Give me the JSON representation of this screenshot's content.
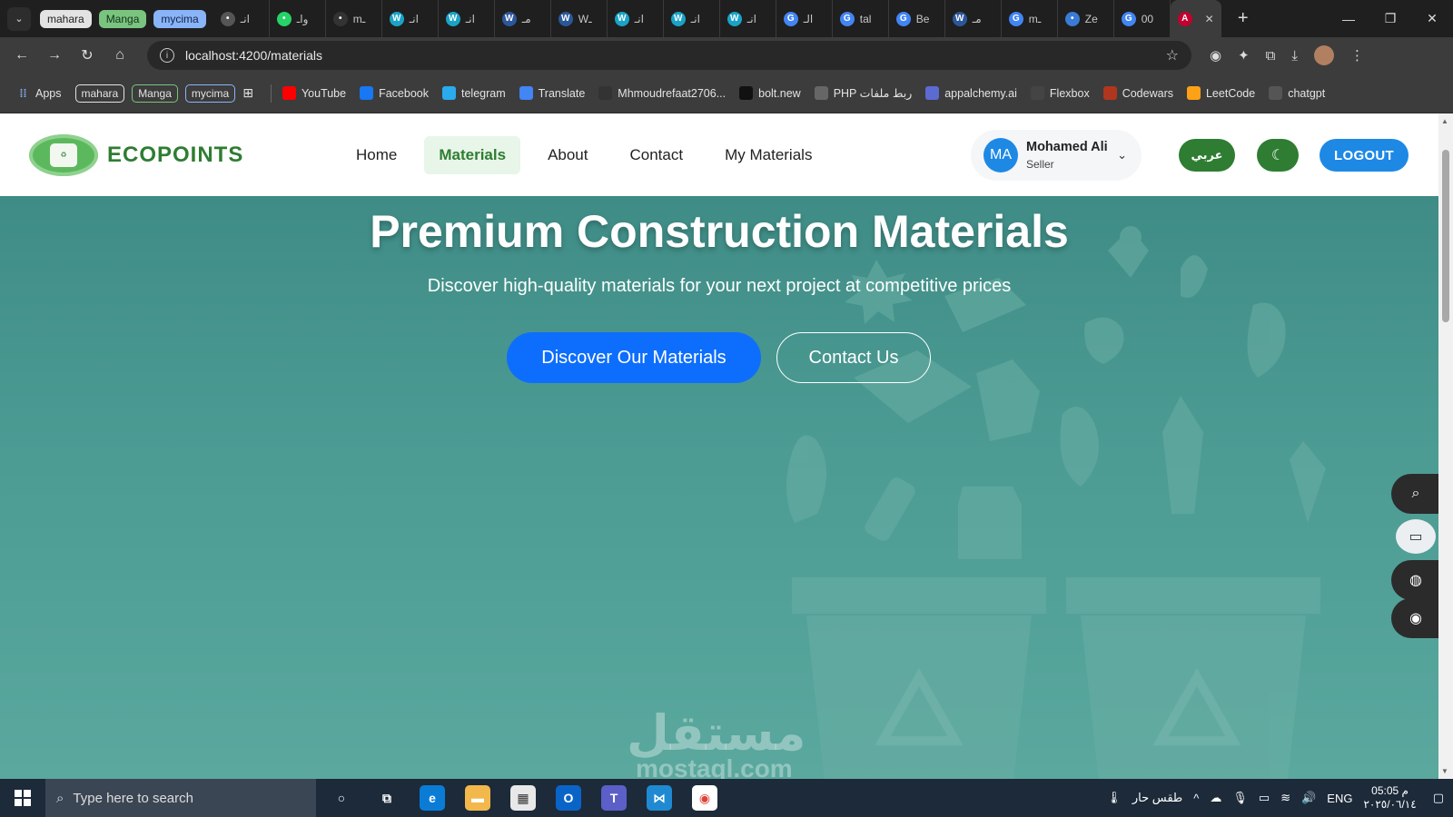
{
  "browser": {
    "tab_groups": [
      "mahara",
      "Manga",
      "mycima"
    ],
    "tabs": [
      {
        "label": "انـ",
        "icon": "openai-icon",
        "color": "#555555"
      },
      {
        "label": "واـ",
        "icon": "whatsapp-icon",
        "color": "#25D366"
      },
      {
        "label": "mـ",
        "icon": "github-icon",
        "color": "#333333"
      },
      {
        "label": "انـ",
        "icon": "w-icon",
        "color": "#1aa3c7"
      },
      {
        "label": "انـ",
        "icon": "w-icon",
        "color": "#1aa3c7"
      },
      {
        "label": "مـ",
        "icon": "w-icon",
        "color": "#2b579a"
      },
      {
        "label": "Wـ",
        "icon": "w-icon",
        "color": "#2b579a"
      },
      {
        "label": "انـ",
        "icon": "w-icon",
        "color": "#1aa3c7"
      },
      {
        "label": "انـ",
        "icon": "w-icon",
        "color": "#1aa3c7"
      },
      {
        "label": "انـ",
        "icon": "w-icon",
        "color": "#1aa3c7"
      },
      {
        "label": "الـ",
        "icon": "google-icon",
        "color": "#4285F4"
      },
      {
        "label": "tal",
        "icon": "google-icon",
        "color": "#4285F4"
      },
      {
        "label": "Be",
        "icon": "google-icon",
        "color": "#4285F4"
      },
      {
        "label": "مـ",
        "icon": "w-icon",
        "color": "#2b579a"
      },
      {
        "label": "mـ",
        "icon": "google-icon",
        "color": "#4285F4"
      },
      {
        "label": "Ze",
        "icon": "ze-icon",
        "color": "#3a7bd5"
      },
      {
        "label": "00",
        "icon": "google-icon",
        "color": "#4285F4"
      }
    ],
    "active_tab_icon": "angular-icon",
    "url": "localhost:4200/materials",
    "bookmarks": {
      "apps": "Apps",
      "groups": [
        "mahara",
        "Manga",
        "mycima"
      ],
      "items": [
        {
          "label": "YouTube",
          "color": "#ff0000"
        },
        {
          "label": "Facebook",
          "color": "#1877f2"
        },
        {
          "label": "telegram",
          "color": "#2aabee"
        },
        {
          "label": "Translate",
          "color": "#4285f4"
        },
        {
          "label": "Mhmoudrefaat2706...",
          "color": "#333333"
        },
        {
          "label": "bolt.new",
          "color": "#111111"
        },
        {
          "label": "PHP ربط ملفات",
          "color": "#666666"
        },
        {
          "label": "appalchemy.ai",
          "color": "#5b6bd1"
        },
        {
          "label": "Flexbox",
          "color": "#444444"
        },
        {
          "label": "Codewars",
          "color": "#b1361e"
        },
        {
          "label": "LeetCode",
          "color": "#ffa116"
        },
        {
          "label": "chatgpt",
          "color": "#555555"
        }
      ]
    }
  },
  "site": {
    "brand": "ECOPOINTS",
    "nav": [
      {
        "label": "Home",
        "active": false
      },
      {
        "label": "Materials",
        "active": true
      },
      {
        "label": "About",
        "active": false
      },
      {
        "label": "Contact",
        "active": false
      },
      {
        "label": "My Materials",
        "active": false
      }
    ],
    "user": {
      "initials": "MA",
      "name": "Mohamed Ali",
      "role": "Seller"
    },
    "lang_button": "عربي",
    "logout": "LOGOUT",
    "hero": {
      "title": "Premium Construction Materials",
      "subtitle": "Discover high-quality materials for your next project at competitive prices",
      "primary_button": "Discover Our Materials",
      "secondary_button": "Contact Us"
    },
    "watermark": "مستقل",
    "watermark_sub": "mostaql.com",
    "colors": {
      "brand_green": "#2e7d32",
      "primary_blue": "#0d6efd",
      "hero_teal": "#4a9a90"
    }
  },
  "taskbar": {
    "search_placeholder": "Type here to search",
    "weather": "طقس حار",
    "lang": "ENG",
    "time": "05:05 م",
    "date": "٢٠٢٥/٠٦/١٤"
  }
}
